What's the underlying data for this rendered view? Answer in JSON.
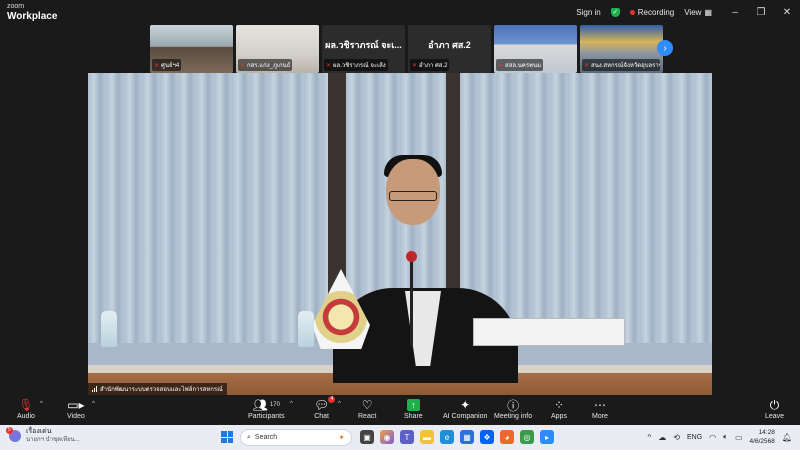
{
  "window": {
    "logo_line1": "zoom",
    "logo_line2": "Workplace",
    "signin": "Sign in",
    "recording": "Recording",
    "view": "View",
    "colors": {
      "recording": "#e5322d",
      "shield": "#1bb14c",
      "accent": "#2d8cff"
    }
  },
  "thumbnails": [
    {
      "label": "ศูนย์ฯ4",
      "muted": true
    },
    {
      "label": "กสร.แก่ง_ภูเกนธ์",
      "muted": true
    },
    {
      "name": "ผล.วชิราภรณ์ จะเ...",
      "label": "ผล.วชิราภรณ์ จะเส้ง",
      "muted": true
    },
    {
      "name": "อำภา ศส.2",
      "label": "อำภา ศส.2",
      "muted": true
    },
    {
      "label": "สสล.นครพนม",
      "muted": true
    },
    {
      "label": "สนง.สหกรณ์จังหวัดอุบลราชธานี",
      "muted": true
    }
  ],
  "main_video": {
    "label": "สำนักพัฒนาระบบตรวจสอบและไฟล์การสหกรณ์"
  },
  "toolbar": {
    "audio": "Audio",
    "video": "Video",
    "participants": "Participants",
    "participants_count": "170",
    "chat": "Chat",
    "chat_badge": "4",
    "react": "React",
    "share": "Share",
    "ai_companion": "AI Companion",
    "meeting_info": "Meeting info",
    "apps": "Apps",
    "more": "More",
    "leave": "Leave"
  },
  "taskbar": {
    "weather_badge": "5",
    "weather_title": "เรื่องเด่น",
    "weather_sub": "นายกฯ นำชุดเทียน...",
    "search_placeholder": "Search",
    "language": "ENG",
    "time": "14:28",
    "date": "4/6/2568"
  }
}
